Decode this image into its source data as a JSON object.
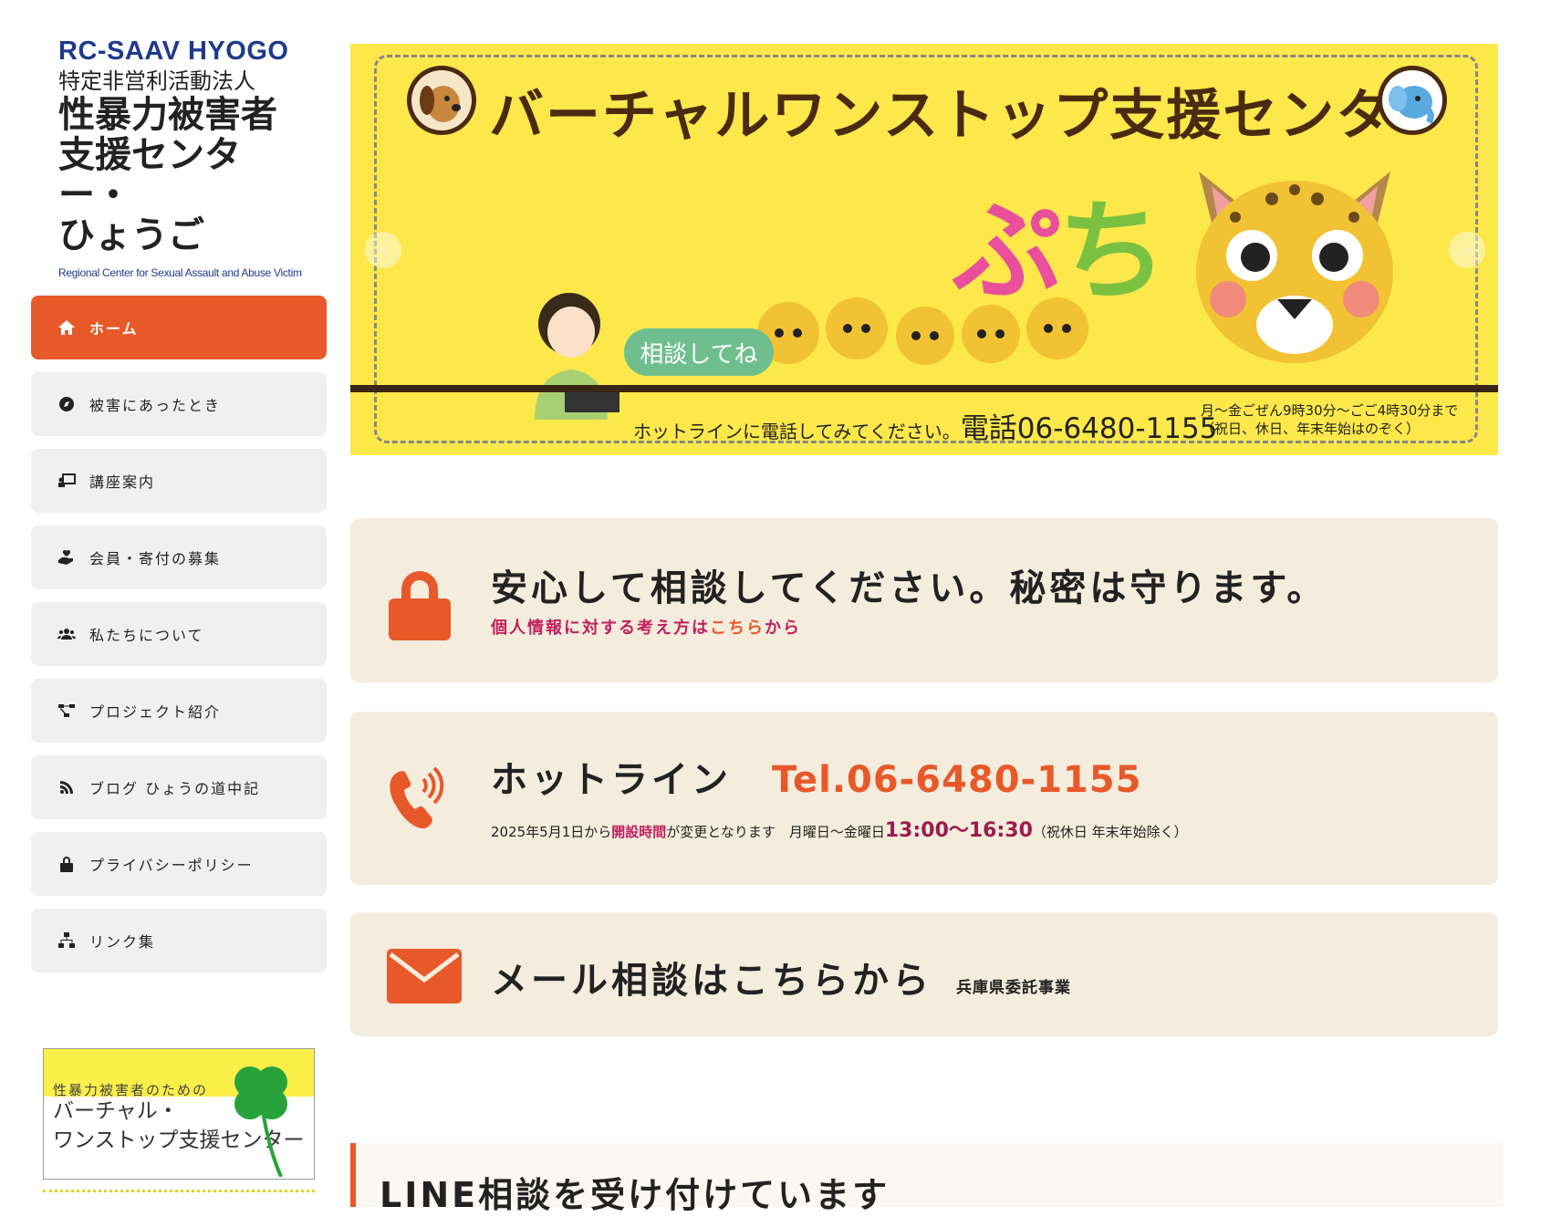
{
  "logo": {
    "en": "RC-SAAV HYOGO",
    "npo": "特定非営利活動法人",
    "line1": "性暴力被害者",
    "line2": "支援センター・",
    "line3": "ひょうご",
    "sub": "Regional Center for Sexual Assault and Abuse Victim"
  },
  "nav": [
    {
      "label": "ホーム",
      "icon": "home-icon",
      "active": true
    },
    {
      "label": "被害にあったとき",
      "icon": "compass-icon"
    },
    {
      "label": "講座案内",
      "icon": "chalkboard-teacher-icon"
    },
    {
      "label": "会員・寄付の募集",
      "icon": "hand-holding-heart-icon"
    },
    {
      "label": "私たちについて",
      "icon": "users-icon"
    },
    {
      "label": "プロジェクト紹介",
      "icon": "project-diagram-icon"
    },
    {
      "label": "ブログ ひょうの道中記",
      "icon": "blog-icon"
    },
    {
      "label": "プライバシーポリシー",
      "icon": "lock-icon"
    },
    {
      "label": "リンク集",
      "icon": "sitemap-icon"
    }
  ],
  "side_banner": {
    "top": "性暴力被害者のための",
    "line1": "バーチャル・",
    "line2": "ワンストップ支援センター"
  },
  "hero": {
    "title": "バーチャルワンストップ支援センター",
    "name_a": "ぷ",
    "name_b": "ち",
    "bubble": "相談してね",
    "hotline_text": "ホットラインに電話してみてください。",
    "hotline_tel": "電話06-6480-1155",
    "hours_1": "月～金ごぜん9時30分～ごご4時30分まで",
    "hours_2": "（祝日、休日、年末年始はのぞく）",
    "prev": "‹",
    "next": "›"
  },
  "privacy": {
    "heading": "安心して相談してください。秘密は守ります。",
    "link_prefix": "個人情報に対する考え方は",
    "link_text": "こちら",
    "link_suffix": "から"
  },
  "hotline": {
    "heading": "ホットライン",
    "tel": "Tel.06-6480-1155",
    "note_1": "2025年5月1日から",
    "note_hl": "開設時間",
    "note_2": "が変更となります　月曜日～金曜日",
    "note_time": "13:00～16:30",
    "note_3": "（祝休日 年末年始除く）"
  },
  "mail": {
    "heading": "メール相談はこちらから",
    "small": "兵庫県委託事業"
  },
  "line": {
    "heading": "LINE相談を受け付けています"
  },
  "colors": {
    "accent": "#e8592a",
    "box_bg": "#f4ecdd",
    "hero_bg": "#fce84b",
    "logo_blue": "#1e3a8c",
    "highlight": "#c0215d"
  }
}
